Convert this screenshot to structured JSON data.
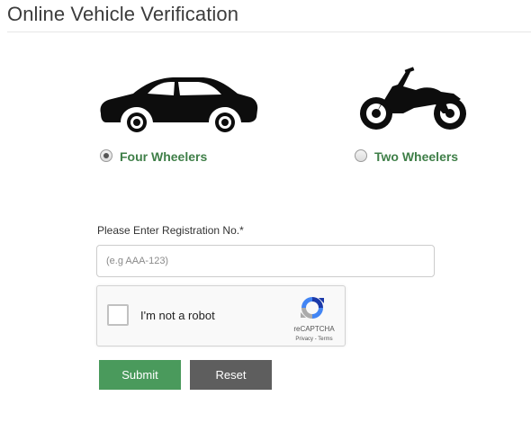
{
  "page": {
    "title": "Online Vehicle Verification"
  },
  "vehicle_types": [
    {
      "label": "Four Wheelers",
      "icon": "car-icon",
      "selected": true
    },
    {
      "label": "Two Wheelers",
      "icon": "motorcycle-icon",
      "selected": false
    }
  ],
  "registration": {
    "label": "Please Enter Registration No.*",
    "placeholder": "(e.g AAA-123)",
    "value": ""
  },
  "recaptcha": {
    "label": "I'm not a robot",
    "brand": "reCAPTCHA",
    "privacy": "Privacy",
    "separator": " - ",
    "terms": "Terms"
  },
  "buttons": {
    "submit": "Submit",
    "reset": "Reset"
  },
  "colors": {
    "accent_green": "#4a9a5c",
    "label_green": "#3f7f48",
    "reset_gray": "#5e5e5e"
  }
}
